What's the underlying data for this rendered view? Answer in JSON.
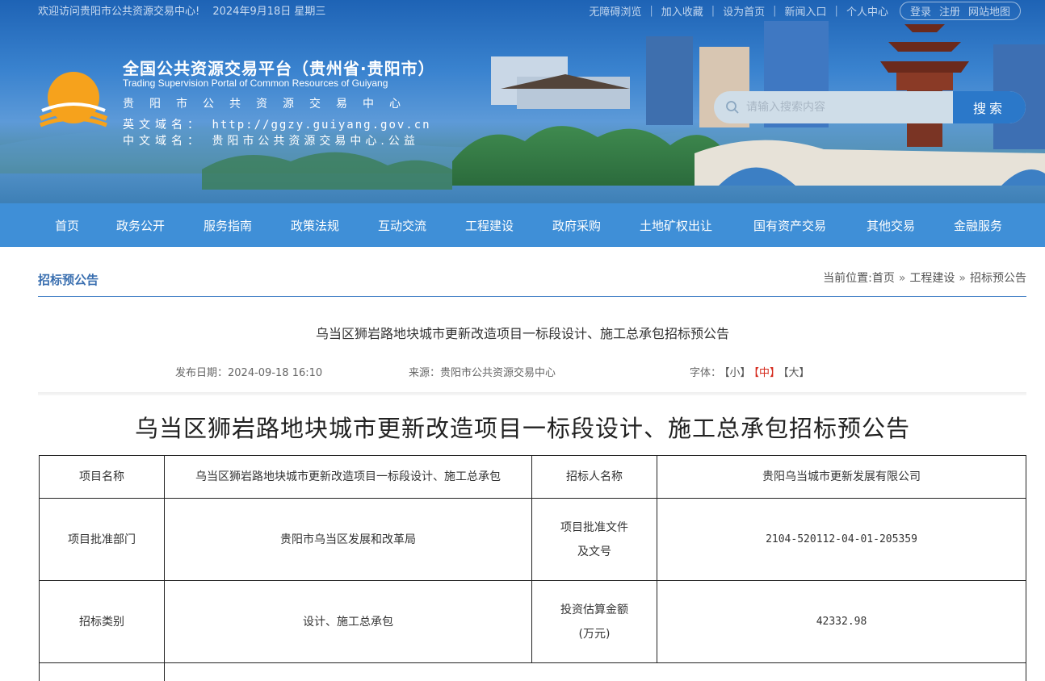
{
  "topbar": {
    "welcome": "欢迎访问贵阳市公共资源交易中心!",
    "date": "2024年9月18日 星期三",
    "links": [
      "无障碍浏览",
      "加入收藏",
      "设为首页",
      "新闻入口",
      "个人中心"
    ],
    "login_label": "登录",
    "register_label": "注册",
    "logout_label": "网站地图"
  },
  "brand": {
    "title": "全国公共资源交易平台（贵州省·贵阳市）",
    "subtitle_en": "Trading Supervision Portal of Common Resources of Guiyang",
    "cn_name": "贵阳市公共资源交易中心",
    "en_domain_label": "英文域名：",
    "en_domain": "http://ggzy.guiyang.gov.cn",
    "cn_domain_label": "中文域名：",
    "cn_domain": "贵阳市公共资源交易中心.公益"
  },
  "search": {
    "placeholder": "请输入搜索内容",
    "button": "搜索"
  },
  "nav": {
    "items": [
      "首页",
      "政务公开",
      "服务指南",
      "政策法规",
      "互动交流",
      "工程建设",
      "政府采购",
      "土地矿权出让",
      "国有资产交易",
      "其他交易",
      "金融服务"
    ]
  },
  "section": {
    "title": "招标预公告",
    "breadcrumb_prefix": "当前位置:",
    "breadcrumb": [
      "首页",
      "工程建设",
      "招标预公告"
    ],
    "arrow": "»"
  },
  "article": {
    "title": "乌当区狮岩路地块城市更新改造项目一标段设计、施工总承包招标预公告",
    "publish_label": "发布日期：",
    "publish_date": "2024-09-18 16:10",
    "source_label": "来源：",
    "source": "贵阳市公共资源交易中心",
    "font_label": "字体：",
    "font_small": "【小】",
    "font_medium": "【中】",
    "font_large": "【大】",
    "heading": "乌当区狮岩路地块城市更新改造项目一标段设计、施工总承包招标预公告"
  },
  "table": {
    "rows": [
      [
        "项目名称",
        "乌当区狮岩路地块城市更新改造项目一标段设计、施工总承包",
        "招标人名称",
        "贵阳乌当城市更新发展有限公司"
      ],
      [
        "项目批准部门",
        "贵阳市乌当区发展和改革局",
        "项目批准文件及文号",
        "2104-520112-04-01-205359"
      ],
      [
        "招标类别",
        "设计、施工总承包",
        "投资估算金额(万元)",
        "42332.98"
      ],
      [
        "",
        "",
        "",
        ""
      ]
    ]
  },
  "colors": {
    "nav_bg": "#3f8fd7",
    "section_title": "#3a6fb0",
    "active_font": "#d52b1e",
    "search_button": "#2b78c9"
  }
}
